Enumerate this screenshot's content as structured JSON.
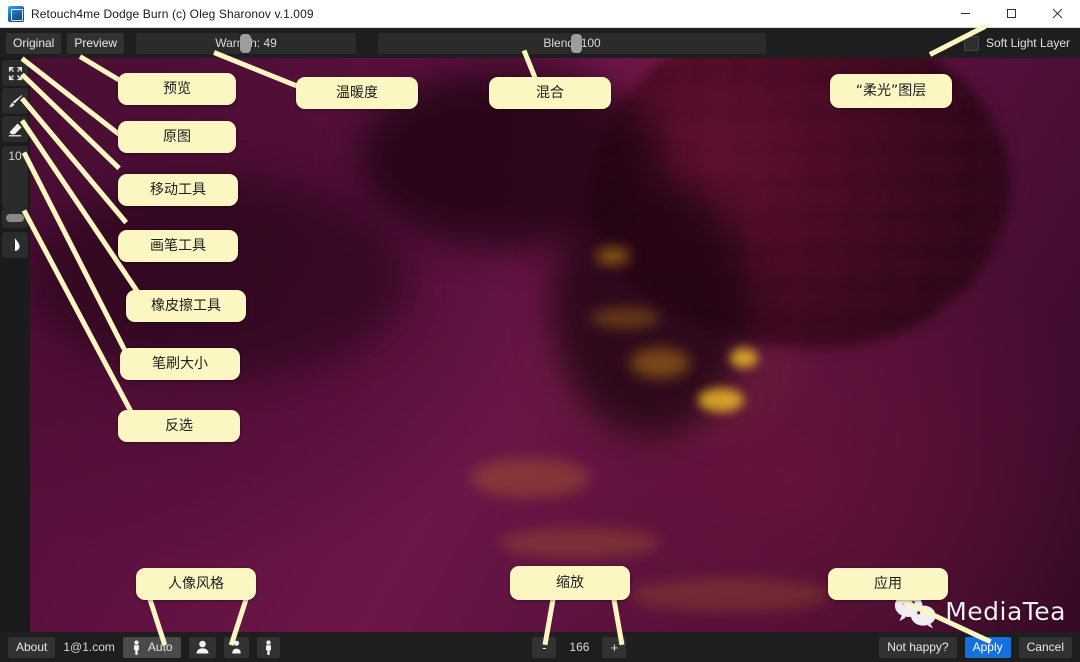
{
  "window": {
    "title": "Retouch4me Dodge Burn (c) Oleg Sharonov v.1.009",
    "app_icon": "cube-icon",
    "minimize": "minimize-icon",
    "maximize": "maximize-icon",
    "close": "close-icon"
  },
  "toolbar": {
    "original_label": "Original",
    "preview_label": "Preview",
    "warmth_label": "Warmth: 49",
    "warmth_value": 49,
    "blend_label": "Blend: 100",
    "blend_value": 100,
    "soft_light_label": "Soft Light Layer",
    "soft_light_checked": false
  },
  "tools": {
    "move_icon": "move-tool-icon",
    "brush_icon": "brush-tool-icon",
    "eraser_icon": "eraser-tool-icon",
    "brush_size_value": "10",
    "brush_size_slider": "brush-size-slider",
    "invert_icon": "invert-selection-icon"
  },
  "statusbar": {
    "about_label": "About",
    "account_email": "1@1.com",
    "auto_label": "Auto",
    "auto_icon": "person-standing-icon",
    "portrait_icon": "person-head-shoulders-icon",
    "halfbody_icon": "person-bust-icon",
    "fullbody_icon": "person-full-body-icon",
    "zoom_out_label": "-",
    "zoom_value": "166",
    "zoom_in_label": "+",
    "not_happy_label": "Not happy?",
    "apply_label": "Apply",
    "cancel_label": "Cancel"
  },
  "annotations": [
    {
      "id": "preview",
      "text": "预览"
    },
    {
      "id": "original",
      "text": "原图"
    },
    {
      "id": "move-tool",
      "text": "移动工具"
    },
    {
      "id": "brush-tool",
      "text": "画笔工具"
    },
    {
      "id": "eraser-tool",
      "text": "橡皮擦工具"
    },
    {
      "id": "brush-size",
      "text": "笔刷大小"
    },
    {
      "id": "invert",
      "text": "反选"
    },
    {
      "id": "warmth",
      "text": "温暖度"
    },
    {
      "id": "blend",
      "text": "混合"
    },
    {
      "id": "soft-light",
      "text": "“柔光”图层"
    },
    {
      "id": "portrait-style",
      "text": "人像风格"
    },
    {
      "id": "zoom",
      "text": "缩放"
    },
    {
      "id": "apply",
      "text": "应用"
    }
  ],
  "watermark": {
    "text": "MediaTea",
    "icon": "wechat-icon"
  },
  "colors": {
    "accent_blue": "#1670dc",
    "callout_yellow": "#fbf6c2",
    "panel_dark": "#1e1e1e",
    "image_magenta": "#6d1648",
    "image_highlight": "#f0c020"
  }
}
